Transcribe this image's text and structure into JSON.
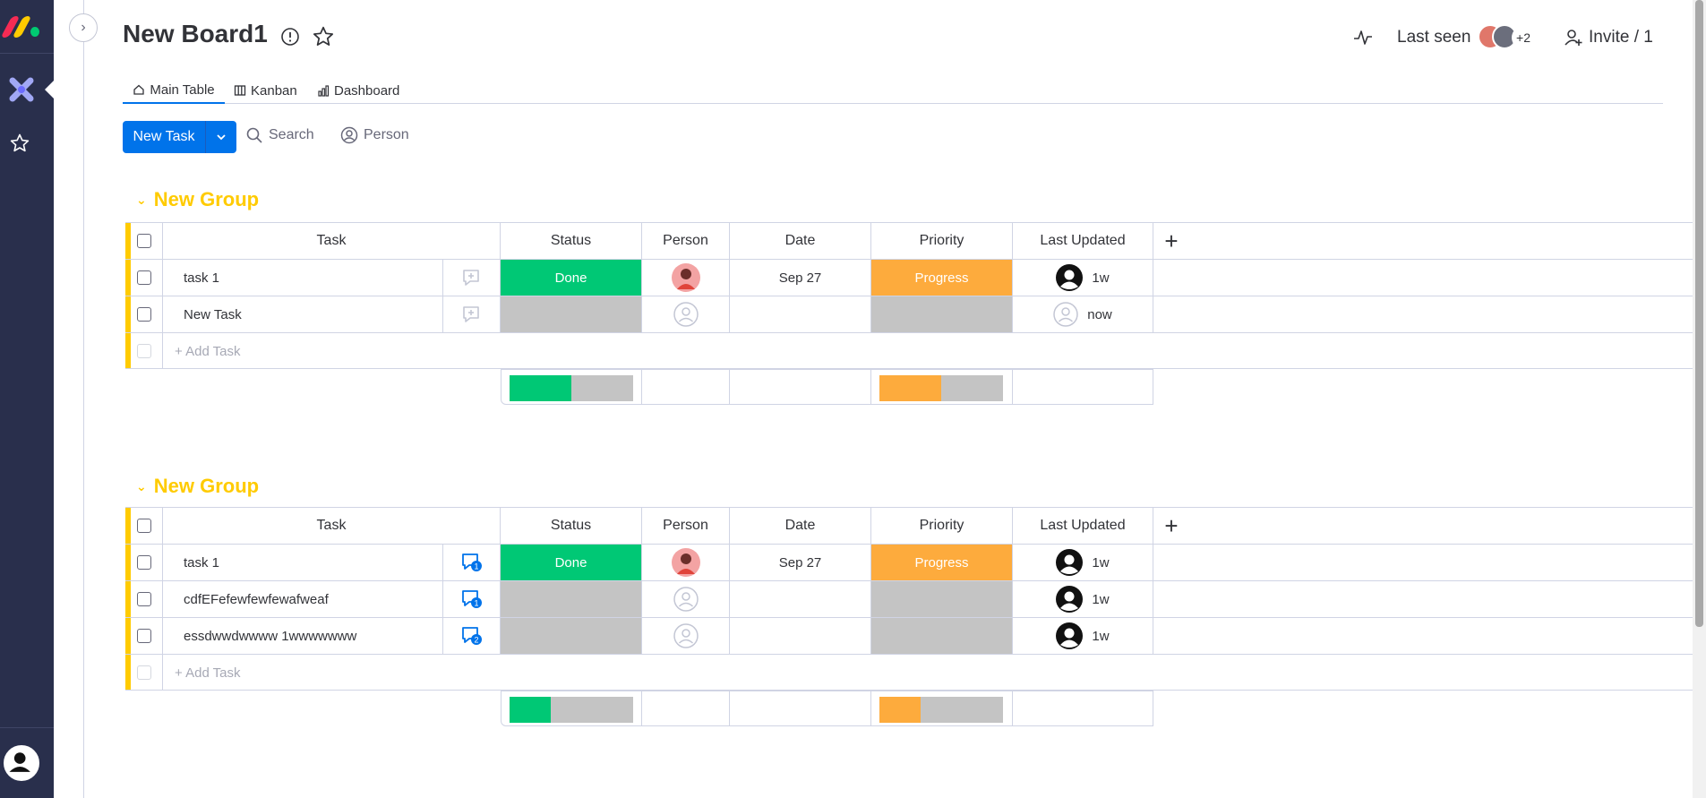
{
  "board": {
    "title": "New Board1"
  },
  "header": {
    "last_seen_label": "Last seen",
    "seen_extra_count": "+2",
    "invite_label": "Invite / 1"
  },
  "tabs": [
    {
      "label": "Main Table",
      "icon": "home-icon"
    },
    {
      "label": "Kanban",
      "icon": "kanban-icon"
    },
    {
      "label": "Dashboard",
      "icon": "chart-icon"
    }
  ],
  "toolbar": {
    "new_task_label": "New Task",
    "search_label": "Search",
    "person_label": "Person"
  },
  "columns": [
    "Task",
    "Status",
    "Person",
    "Date",
    "Priority",
    "Last Updated"
  ],
  "add_task_label": "+ Add Task",
  "colors": {
    "accent": "#0073ea",
    "group": "#ffcb00",
    "done": "#00c875",
    "progress": "#fdab3d",
    "empty": "#c4c4c4",
    "rail": "#292f4c"
  },
  "groups": [
    {
      "title": "New Group",
      "rows": [
        {
          "task": "task 1",
          "status": "Done",
          "person": "avatar",
          "date": "Sep 27",
          "priority": "Progress",
          "updated": "1w",
          "updated_avatar": "filled",
          "comments": ""
        },
        {
          "task": "New Task",
          "status": "",
          "person": "empty",
          "date": "",
          "priority": "",
          "updated": "now",
          "updated_avatar": "ghost",
          "comments": ""
        }
      ],
      "summary": {
        "status_done_fraction": 0.5,
        "priority_progress_fraction": 0.5
      }
    },
    {
      "title": "New Group",
      "rows": [
        {
          "task": "task 1",
          "status": "Done",
          "person": "avatar",
          "date": "Sep 27",
          "priority": "Progress",
          "updated": "1w",
          "updated_avatar": "filled",
          "comments": "1"
        },
        {
          "task": "cdfEFefewfewfewafweaf",
          "status": "",
          "person": "empty",
          "date": "",
          "priority": "",
          "updated": "1w",
          "updated_avatar": "filled",
          "comments": "1"
        },
        {
          "task": "essdwwdwwww 1wwwwwww",
          "status": "",
          "person": "empty",
          "date": "",
          "priority": "",
          "updated": "1w",
          "updated_avatar": "filled",
          "comments": "2"
        }
      ],
      "summary": {
        "status_done_fraction": 0.33,
        "priority_progress_fraction": 0.33
      }
    }
  ]
}
